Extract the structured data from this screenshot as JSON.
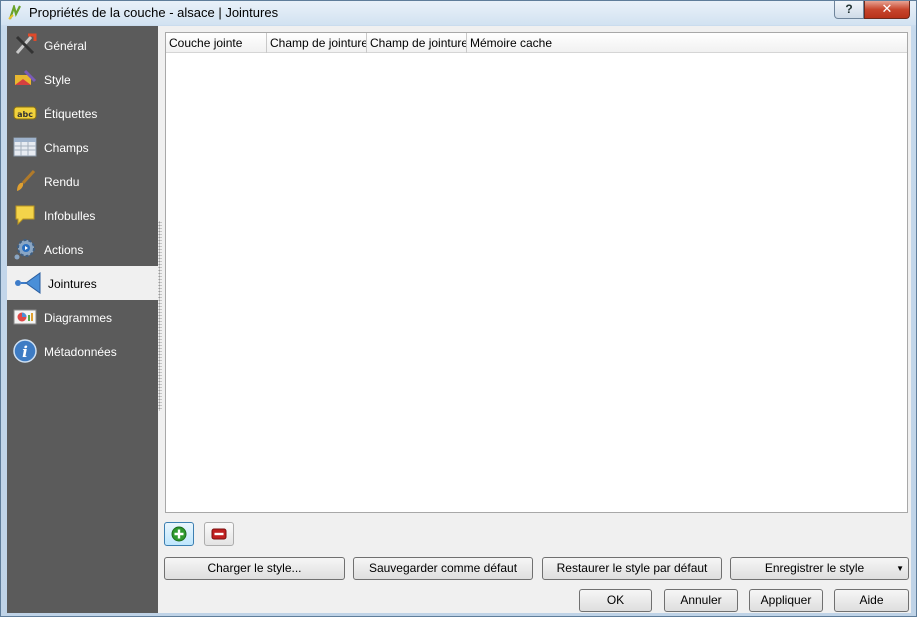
{
  "window": {
    "title": "Propriétés de la couche - alsace | Jointures",
    "help_label": "?",
    "close_label": "✕"
  },
  "sidebar": {
    "items": [
      {
        "label": "Général",
        "icon": "general-tools-icon"
      },
      {
        "label": "Style",
        "icon": "style-brush-icon"
      },
      {
        "label": "Étiquettes",
        "icon": "labels-abc-icon"
      },
      {
        "label": "Champs",
        "icon": "fields-table-icon"
      },
      {
        "label": "Rendu",
        "icon": "rendering-brush-icon"
      },
      {
        "label": "Infobulles",
        "icon": "tooltip-bubble-icon"
      },
      {
        "label": "Actions",
        "icon": "actions-gear-icon"
      },
      {
        "label": "Jointures",
        "icon": "joins-icon",
        "selected": true
      },
      {
        "label": "Diagrammes",
        "icon": "diagrams-icon"
      },
      {
        "label": "Métadonnées",
        "icon": "metadata-info-icon"
      }
    ]
  },
  "joins_table": {
    "columns": [
      "Couche jointe",
      "Champ de jointure cible",
      "Champ de jointure source",
      "Mémoire cache"
    ],
    "rows": []
  },
  "style_buttons": {
    "load": "Charger le style...",
    "save_default": "Sauvegarder comme défaut",
    "restore_default": "Restaurer le style par défaut",
    "save_style": "Enregistrer le style",
    "save_style_arrow": "▼"
  },
  "dialog_buttons": {
    "ok": "OK",
    "cancel": "Annuler",
    "apply": "Appliquer",
    "help": "Aide"
  },
  "colors": {
    "sidebar_bg": "#5b5b5b",
    "selected_item_bg": "#f0f0f0",
    "add_icon": "#2e9a2e",
    "remove_icon": "#c02020"
  }
}
